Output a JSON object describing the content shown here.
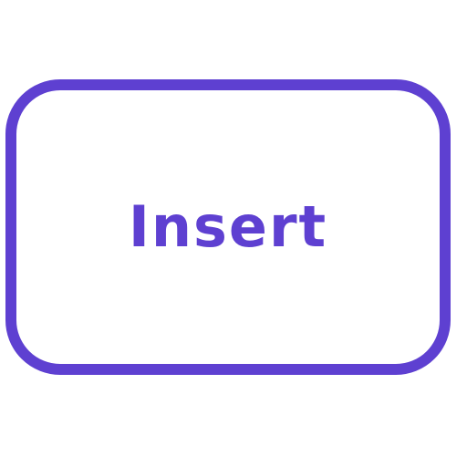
{
  "key": {
    "label": "Insert",
    "border_color": "#5e40d1",
    "text_color": "#5e40d1",
    "background_color": "#ffffff"
  }
}
